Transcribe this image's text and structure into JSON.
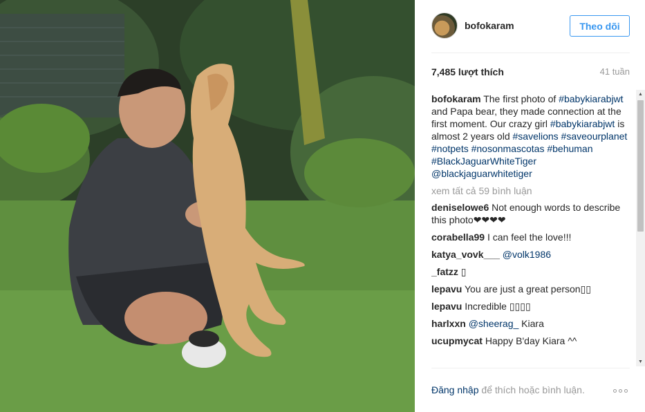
{
  "post": {
    "photo_icon": "lion-cub-photo",
    "author": "bofokaram",
    "follow_label": "Theo dõi",
    "likes": "7,485 lượt thích",
    "age": "41 tuần"
  },
  "caption": {
    "user": "bofokaram",
    "t1": " The first photo of ",
    "tag1": "#babykiarabjwt",
    "t2": " and Papa bear, they made connection at the first moment. Our crazy girl ",
    "tag2": "#babykiarabjwt",
    "t3": " is almost 2 years old ",
    "tag3": "#savelions",
    "tag4": "#saveourplanet",
    "tag5": "#notpets",
    "tag6": "#nosonmascotas",
    "tag7": "#behuman",
    "tag8": "#BlackJaguarWhiteTiger",
    "mention": "@blackjaguarwhitetiger"
  },
  "view_all": "xem tất cả 59 bình luận",
  "comments": [
    {
      "user": "deniselowe6",
      "text": "Not enough words to describe this photo❤❤❤❤"
    },
    {
      "user": "corabella99",
      "text": "I can feel the love!!!"
    },
    {
      "user": "katya_vovk___",
      "text": "",
      "mention": "@volk1986"
    },
    {
      "user": "_fatzz",
      "text": "▯"
    },
    {
      "user": "lepavu",
      "text": "You are just a great person▯▯"
    },
    {
      "user": "lepavu",
      "text": "Incredible ▯▯▯▯"
    },
    {
      "user": "harlxxn",
      "text": " Kiara",
      "mention": "@sheerag_"
    },
    {
      "user": "ucupmycat",
      "text": "Happy B'day Kiara ^^"
    }
  ],
  "footer": {
    "login_link": "Đăng nhập",
    "login_rest": " để thích hoặc bình luận.",
    "more_icon": "more-options-icon"
  },
  "colors": {
    "accent": "#3897f0",
    "link": "#003569",
    "muted": "#999999"
  }
}
